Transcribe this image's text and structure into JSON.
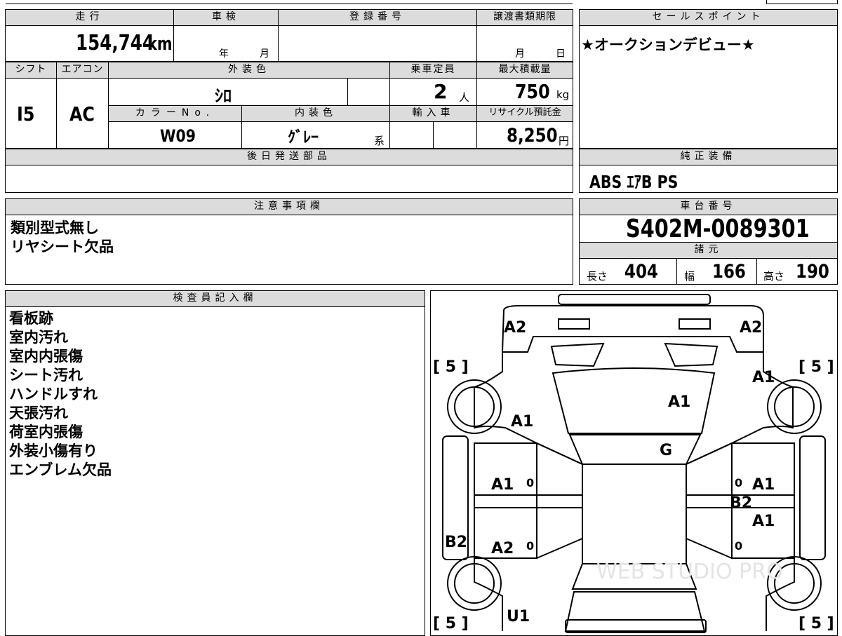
{
  "basic": {
    "mileage_label": "走行",
    "mileage": "154,744",
    "mileage_unit": "km",
    "inspection_label": "車検",
    "inspection_year_unit": "年",
    "inspection_month_unit": "月",
    "registration_label": "登録番号",
    "transfer_label": "譲渡書類期限",
    "transfer_month_unit": "月",
    "transfer_day_unit": "日",
    "shift_label": "シフト",
    "shift": "I5",
    "ac_label": "エアコン",
    "ac": "AC",
    "exterior_color_label": "外装色",
    "exterior_color": "ｼﾛ",
    "capacity_label": "乗車定員",
    "capacity": "2",
    "capacity_unit": "人",
    "max_load_label": "最大積載量",
    "max_load": "750",
    "max_load_unit": "kg",
    "color_no_label": "カラーNo.",
    "color_no": "W09",
    "interior_color_label": "内装色",
    "interior_color": "ｸﾞﾚｰ",
    "interior_color_suffix": "系",
    "import_label": "輸入車",
    "recycle_label": "リサイクル預託金",
    "recycle_fee": "8,250",
    "recycle_unit": "円",
    "later_parts_label": "後日発送部品"
  },
  "sales_point": {
    "label": "セールスポイント",
    "text": "★オークションデビュー★"
  },
  "equipment": {
    "label": "純正装備",
    "text": "ABS ｴｱB PS"
  },
  "notes": {
    "label": "注意事項欄",
    "lines": [
      "類別型式無し",
      "リヤシート欠品"
    ]
  },
  "chassis": {
    "label": "車台番号",
    "number": "S402M-0089301",
    "specs_label": "諸元",
    "length_label": "長さ",
    "length": "404",
    "width_label": "幅",
    "width": "166",
    "height_label": "高さ",
    "height": "190"
  },
  "inspector": {
    "label": "検査員記入欄",
    "lines": [
      "看板跡",
      "室内汚れ",
      "室内内張傷",
      "シート汚れ",
      "ハンドルすれ",
      "天張汚れ",
      "荷室内張傷",
      "外装小傷有り",
      "エンブレム欠品"
    ]
  },
  "diagram": {
    "marks": {
      "front_left": "A2",
      "front_right": "A2",
      "hood": "A1",
      "left_front_fender": "A1",
      "right_front_fender": "A1",
      "windshield": "G",
      "left_front_door": "A1",
      "left_rear_door": "A2",
      "right_front_door": "A1",
      "right_pillar": "B2",
      "right_rear_door": "A1",
      "left_sill": "B2",
      "rear_left": "U1"
    },
    "tire_labels": [
      "[ 5 ]",
      "[ 5 ]",
      "[ 5 ]",
      "[ 5 ]"
    ],
    "zero_marks": [
      "0",
      "0",
      "0",
      "0"
    ],
    "watermark": "WEB STUDIO PRO"
  }
}
